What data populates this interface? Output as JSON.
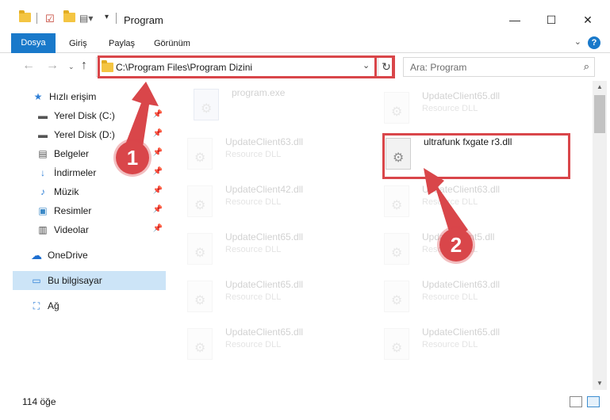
{
  "window": {
    "title": "Program",
    "minimize": "—",
    "maximize": "☐",
    "close": "✕"
  },
  "ribbon": {
    "tabs": [
      "Dosya",
      "Giriş",
      "Paylaş",
      "Görünüm"
    ],
    "help": "?"
  },
  "nav": {
    "address": "C:\\Program Files\\Program Dizini",
    "search_placeholder": "Ara: Program"
  },
  "sidebar": {
    "items": [
      {
        "label": "Hızlı erişim",
        "icon": "star-icon"
      },
      {
        "label": "Yerel Disk (C:)",
        "icon": "drive-icon"
      },
      {
        "label": "Yerel Disk (D:)",
        "icon": "drive-icon"
      },
      {
        "label": "Belgeler",
        "icon": "document-icon"
      },
      {
        "label": "İndirmeler",
        "icon": "download-icon"
      },
      {
        "label": "Müzik",
        "icon": "music-icon"
      },
      {
        "label": "Resimler",
        "icon": "picture-icon"
      },
      {
        "label": "Videolar",
        "icon": "video-icon"
      },
      {
        "label": "OneDrive",
        "icon": "cloud-icon"
      },
      {
        "label": "Bu bilgisayar",
        "icon": "computer-icon"
      },
      {
        "label": "Ağ",
        "icon": "network-icon"
      }
    ]
  },
  "files": [
    {
      "name": "program.exe",
      "type": ""
    },
    {
      "name": "UpdateClient65.dll",
      "type": "Resource DLL"
    },
    {
      "name": "UpdateClient63.dll",
      "type": "Resource DLL"
    },
    {
      "name": "ultrafunk fxgate r3.dll",
      "type": ""
    },
    {
      "name": "UpdateClient42.dll",
      "type": "Resource DLL"
    },
    {
      "name": "UpdateClient63.dll",
      "type": "Resource DLL"
    },
    {
      "name": "UpdateClient65.dll",
      "type": "Resource DLL"
    },
    {
      "name": "UpdateClient5.dll",
      "type": "Resource DLL"
    },
    {
      "name": "UpdateClient65.dll",
      "type": "Resource DLL"
    },
    {
      "name": "UpdateClient63.dll",
      "type": "Resource DLL"
    },
    {
      "name": "UpdateClient65.dll",
      "type": "Resource DLL"
    },
    {
      "name": "UpdateClient65.dll",
      "type": "Resource DLL"
    }
  ],
  "status": {
    "count": "114 öğe"
  },
  "callouts": [
    "1",
    "2"
  ],
  "colors": {
    "accent": "#1979ca",
    "highlight": "#d9464a",
    "selected": "#cce4f7"
  }
}
